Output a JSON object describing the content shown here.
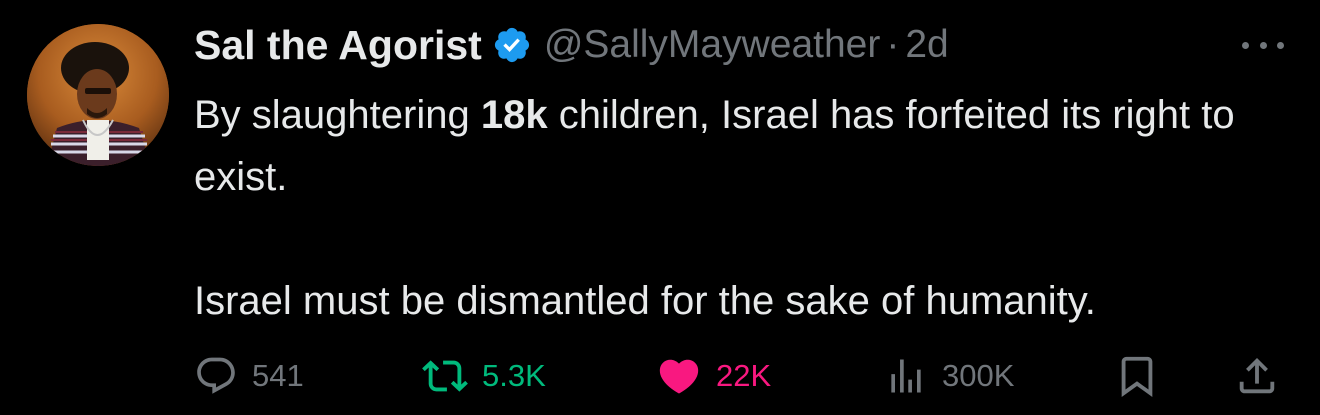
{
  "author": {
    "name": "Sal the Agorist",
    "handle": "@SallyMayweather",
    "separator": "·",
    "time": "2d",
    "verified": true
  },
  "tweet": {
    "line1_before": "By slaughtering ",
    "line1_bold": "18k",
    "line1_after": " children, Israel has forfeited its right to exist.",
    "line2": "Israel must be dismantled for the sake of humanity."
  },
  "actions": {
    "replies": "541",
    "reposts": "5.3K",
    "likes": "22K",
    "views": "300K"
  },
  "colors": {
    "background": "#000000",
    "text": "#e7e9ea",
    "muted": "#71767b",
    "verified": "#1d9bf0",
    "repost": "#00ba7c",
    "like": "#f91880"
  },
  "icons": {
    "verified": "verified-badge-icon",
    "more": "more-horizontal-icon",
    "reply": "reply-icon",
    "repost": "repost-icon",
    "like": "heart-icon",
    "views": "analytics-icon",
    "bookmark": "bookmark-icon",
    "share": "share-icon"
  }
}
